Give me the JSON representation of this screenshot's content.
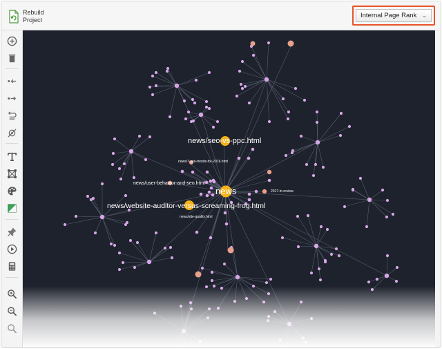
{
  "toolbar": {
    "rebuild_label": "Rebuild\nProject",
    "view_select": "Internal Page Rank"
  },
  "sidebar": {
    "tools": [
      "add-icon",
      "trash-icon",
      "collapse-left-icon",
      "expand-right-icon",
      "undo-icon",
      "unlink-icon",
      "text-icon",
      "fit-nodes-icon",
      "palette-icon",
      "color-toggle-icon",
      "pin-icon",
      "play-icon",
      "calculator-icon",
      "zoom-in-icon",
      "zoom-out-icon",
      "zoom-reset-icon"
    ]
  },
  "graph": {
    "labels": {
      "news": "news",
      "seo_vs_ppc": "news/seo-vs-ppc.html",
      "seo_trends": "news/7-seo-trends-for-2016.html",
      "user_behavior": "news/user-behavior-and-seo.html",
      "website_auditor": "news/website-auditor-versus-screaming-frog.html",
      "site_quality": "news/site-quality.html",
      "review_2017": "2017-in-review"
    },
    "colors": {
      "background": "#1e222d",
      "edge": "#6b7184",
      "leaf": "#d7a6e6",
      "hub": "#e8a08a",
      "major": "#f5b21a",
      "accent_border": "#e8542a"
    }
  }
}
